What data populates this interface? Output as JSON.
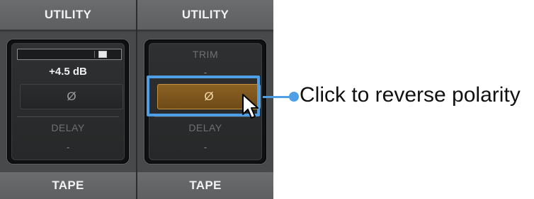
{
  "strips": [
    {
      "header": "UTILITY",
      "footer": "TAPE",
      "gain_value": "+4.5 dB",
      "phase_symbol": "Ø",
      "delay_label": "DELAY",
      "delay_value": "-",
      "polarity_active": false
    },
    {
      "header": "UTILITY",
      "footer": "TAPE",
      "trim_label": "TRIM",
      "trim_value": "-",
      "phase_symbol": "Ø",
      "delay_label": "DELAY",
      "delay_value": "-",
      "polarity_active": true
    }
  ],
  "callout": {
    "text": "Click to reverse polarity",
    "color": "#4f9fe6"
  },
  "colors": {
    "button_active": "#8c6224",
    "button_active_border": "#c7923f",
    "header_bg": "#6a6c6e"
  }
}
